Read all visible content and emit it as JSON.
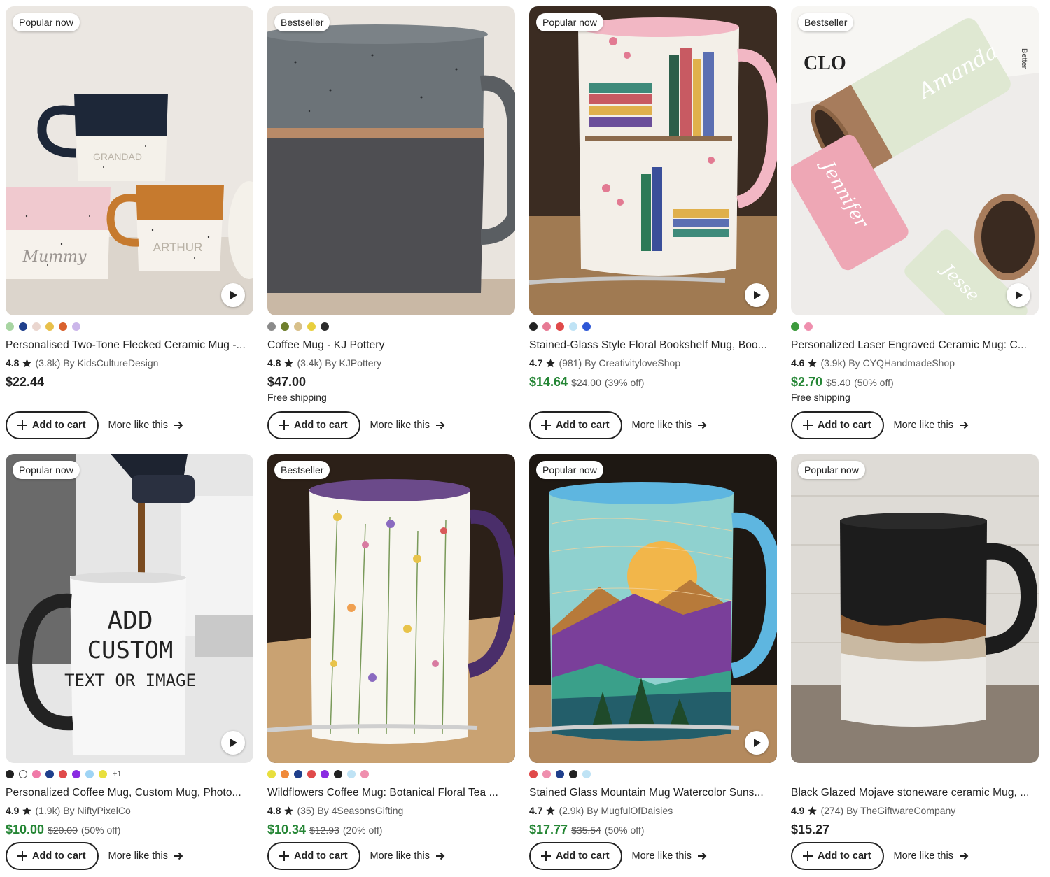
{
  "products": [
    {
      "badge": "Popular now",
      "has_video": true,
      "swatches": [
        "#a8d5a2",
        "#1f3f8c",
        "#ead6cf",
        "#e8c04a",
        "#d9612e",
        "#cbb6ea"
      ],
      "title": "Personalised Two-Tone Flecked Ceramic Mug -...",
      "rating": "4.8",
      "reviews": "(3.8k)",
      "shop": "By KidsCultureDesign",
      "price": "$22.44",
      "orig_price": "",
      "discount": "",
      "shipping": "",
      "add_label": "Add to cart",
      "more_label": "More like this",
      "mug_text": [
        "GRANDAD",
        "Mummy",
        "ARTHUR"
      ]
    },
    {
      "badge": "Bestseller",
      "has_video": false,
      "swatches": [
        "#8a8a8a",
        "#6f7f2d",
        "#d8c08a",
        "#e8cf3e",
        "#2b2b2b"
      ],
      "title": "Coffee Mug - KJ Pottery",
      "rating": "4.8",
      "reviews": "(3.4k)",
      "shop": "By KJPottery",
      "price": "$47.00",
      "orig_price": "",
      "discount": "",
      "shipping": "Free shipping",
      "add_label": "Add to cart",
      "more_label": "More like this"
    },
    {
      "badge": "Popular now",
      "has_video": true,
      "swatches": [
        "#222222",
        "#e77a94",
        "#e04a4a",
        "#bfe3f5",
        "#2d57d6"
      ],
      "title": "Stained-Glass Style Floral Bookshelf Mug, Boo...",
      "rating": "4.7",
      "reviews": "(981)",
      "shop": "By CreativityloveShop",
      "price": "$14.64",
      "orig_price": "$24.00",
      "discount": "(39% off)",
      "shipping": "",
      "add_label": "Add to cart",
      "more_label": "More like this"
    },
    {
      "badge": "Bestseller",
      "has_video": true,
      "swatches": [
        "#3c9a3c",
        "#ef8fae"
      ],
      "title": "Personalized Laser Engraved Ceramic Mug: C...",
      "rating": "4.6",
      "reviews": "(3.9k)",
      "shop": "By CYQHandmadeShop",
      "price": "$2.70",
      "orig_price": "$5.40",
      "discount": "(50% off)",
      "shipping": "Free shipping",
      "add_label": "Add to cart",
      "more_label": "More like this",
      "mug_text": [
        "Amanda",
        "Jennifer",
        "Jesse",
        "CLO",
        "Better"
      ]
    },
    {
      "badge": "Popular now",
      "has_video": true,
      "swatches": [
        "#222222",
        "#ffffff",
        "#f07aa8",
        "#1f3f8c",
        "#e04a4a",
        "#8a2be2",
        "#9fd4f5",
        "#e8df3e"
      ],
      "swatch_more": "+1",
      "title": "Personalized Coffee Mug, Custom Mug, Photo...",
      "rating": "4.9",
      "reviews": "(1.9k)",
      "shop": "By NiftyPixelCo",
      "price": "$10.00",
      "orig_price": "$20.00",
      "discount": "(50% off)",
      "shipping": "",
      "add_label": "Add to cart",
      "more_label": "More like this",
      "mug_text": [
        "ADD",
        "CUSTOM",
        "TEXT OR IMAGE"
      ]
    },
    {
      "badge": "Bestseller",
      "has_video": false,
      "swatches": [
        "#e8df3e",
        "#f08a3a",
        "#1f3f8c",
        "#e04a4a",
        "#8a2be2",
        "#222222",
        "#bfe3f5",
        "#ef8fae"
      ],
      "title": "Wildflowers Coffee Mug: Botanical Floral Tea ...",
      "rating": "4.8",
      "reviews": "(35)",
      "shop": "By 4SeasonsGifting",
      "price": "$10.34",
      "orig_price": "$12.93",
      "discount": "(20% off)",
      "shipping": "",
      "add_label": "Add to cart",
      "more_label": "More like this"
    },
    {
      "badge": "Popular now",
      "has_video": true,
      "swatches": [
        "#e04a4a",
        "#ef8fae",
        "#1f3f8c",
        "#222222",
        "#bfe3f5"
      ],
      "title": "Stained Glass Mountain Mug Watercolor Suns...",
      "rating": "4.7",
      "reviews": "(2.9k)",
      "shop": "By MugfulOfDaisies",
      "price": "$17.77",
      "orig_price": "$35.54",
      "discount": "(50% off)",
      "shipping": "",
      "add_label": "Add to cart",
      "more_label": "More like this"
    },
    {
      "badge": "Popular now",
      "has_video": false,
      "swatches": [],
      "title": "Black Glazed Mojave stoneware ceramic Mug, ...",
      "rating": "4.9",
      "reviews": "(274)",
      "shop": "By TheGiftwareCompany",
      "price": "$15.27",
      "orig_price": "",
      "discount": "",
      "shipping": "",
      "add_label": "Add to cart",
      "more_label": "More like this"
    }
  ],
  "colors": {
    "sale_green": "#258635",
    "text": "#222222",
    "muted": "#595959"
  },
  "icons": {
    "play": "play-icon",
    "star": "star-icon",
    "plus": "plus-icon",
    "arrow": "arrow-right-icon"
  }
}
